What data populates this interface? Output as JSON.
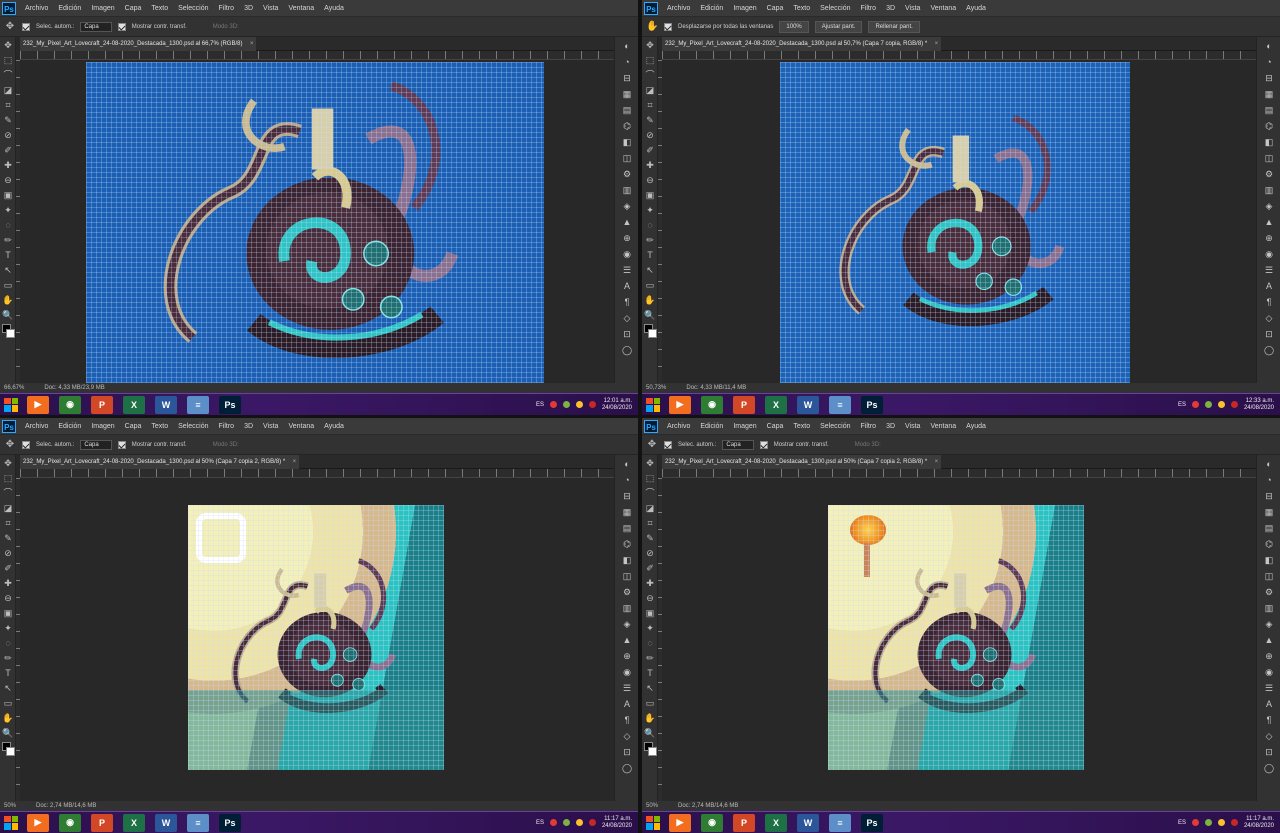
{
  "menu": [
    "Archivo",
    "Edición",
    "Imagen",
    "Capa",
    "Texto",
    "Selección",
    "Filtro",
    "3D",
    "Vista",
    "Ventana",
    "Ayuda"
  ],
  "options": {
    "auto_select_label": "Selec. autom.:",
    "auto_select_value": "Capa",
    "transform_label": "Mostrar contr. transf.",
    "mode3d_label": "Modo 3D:",
    "scroll_all_label": "Desplazarse por todas las ventanas",
    "zoom_100": "100%",
    "fit_screen": "Ajustar pant.",
    "fill_screen": "Rellenar pant."
  },
  "panes": [
    {
      "tab": "232_My_Pixel_Art_Lovecraft_24-08-2020_Destacada_1300.psd al 66,7% (RGB/8)",
      "zoom": "66,67%",
      "doc": "Doc: 4,33 MB/23,9 MB",
      "time": "12:01 a.m.",
      "date": "24/08/2020",
      "lang": "ES"
    },
    {
      "tab": "232_My_Pixel_Art_Lovecraft_24-08-2020_Destacada_1300.psd al 50,7% (Capa 7 copia, RGB/8) *",
      "zoom": "50,73%",
      "doc": "Doc: 4,33 MB/11,4 MB",
      "time": "12:33 a.m.",
      "date": "24/08/2020",
      "lang": "ES"
    },
    {
      "tab": "232_My_Pixel_Art_Lovecraft_24-08-2020_Destacada_1300.psd al 50% (Capa 7 copia 2, RGB/8) *",
      "zoom": "50%",
      "doc": "Doc: 2,74 MB/14,6 MB",
      "time": "11:17 a.m.",
      "date": "24/08/2020",
      "lang": "ES"
    },
    {
      "tab": "232_My_Pixel_Art_Lovecraft_24-08-2020_Destacada_1300.psd al 50% (Capa 7 copia 2, RGB/8) *",
      "zoom": "50%",
      "doc": "Doc: 2,74 MB/14,6 MB",
      "time": "11:17 a.m.",
      "date": "24/08/2020",
      "lang": "ES"
    }
  ],
  "taskbar_apps": [
    {
      "icon": "media-player-icon",
      "color": "#f36d1e",
      "glyph": "▶"
    },
    {
      "icon": "chrome-icon",
      "color": "#2e7d32",
      "glyph": "◉"
    },
    {
      "icon": "powerpoint-icon",
      "color": "#d24726",
      "glyph": "P"
    },
    {
      "icon": "excel-icon",
      "color": "#1e7145",
      "glyph": "X"
    },
    {
      "icon": "word-icon",
      "color": "#2b579a",
      "glyph": "W"
    },
    {
      "icon": "notepad-icon",
      "color": "#5c8fc7",
      "glyph": "≡"
    },
    {
      "icon": "photoshop-icon",
      "color": "#001e36",
      "glyph": "Ps"
    }
  ],
  "colors": {
    "accent_photoshop": "#31a8ff",
    "canvas_blue": "#1a5fb4",
    "workspace": "#282828"
  }
}
